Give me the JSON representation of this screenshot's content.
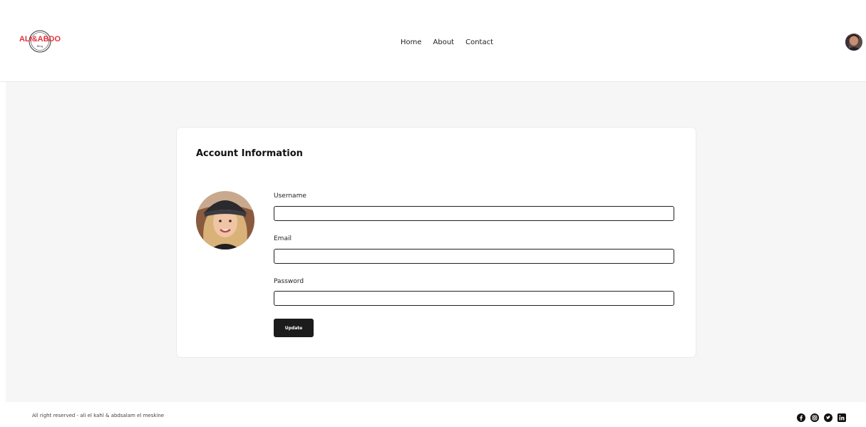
{
  "header": {
    "logo_text": "ALI&ABDO",
    "logo_subtext": "blog",
    "nav": [
      {
        "label": "Home"
      },
      {
        "label": "About"
      },
      {
        "label": "Contact"
      }
    ],
    "avatar_icon": "user-avatar"
  },
  "card": {
    "title": "Account Information",
    "fields": [
      {
        "label": "Username",
        "value": "",
        "placeholder": ""
      },
      {
        "label": "Email",
        "value": "",
        "placeholder": ""
      },
      {
        "label": "Password",
        "value": "",
        "placeholder": ""
      }
    ],
    "update_label": "Update"
  },
  "footer": {
    "text": "All right reserved - ali el kahl & abdsalam el meskine",
    "socials": [
      "facebook-icon",
      "instagram-icon",
      "twitter-icon",
      "linkedin-icon"
    ]
  },
  "colors": {
    "logo_red": "#e2333d",
    "button_dark": "#1c1c1c",
    "page_bg": "#f6f6f6"
  }
}
